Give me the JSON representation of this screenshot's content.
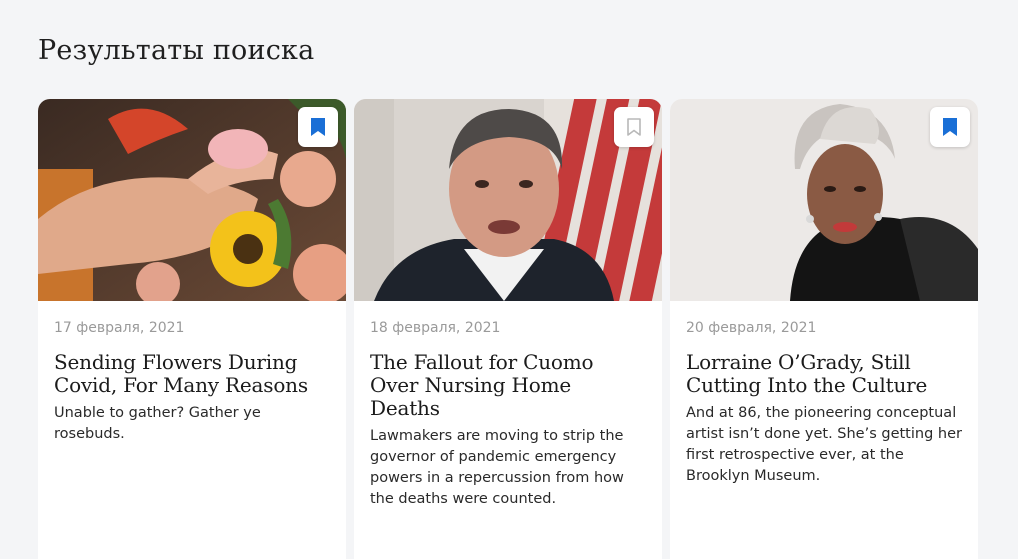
{
  "page": {
    "title": "Результаты поиска"
  },
  "colors": {
    "background": "#f4f5f7",
    "bookmark_active": "#1a6fd6",
    "bookmark_inactive": "#b8b8b8",
    "date_text": "#9a9a9a"
  },
  "cards": [
    {
      "date": "17 февраля, 2021",
      "title": "Sending Flowers During Covid, For Many Reasons",
      "description": "Unable to gather? Gather ye rosebuds.",
      "bookmarked": true,
      "image_icon": "flowers-photo"
    },
    {
      "date": "18 февраля, 2021",
      "title": "The Fallout for Cuomo Over Nursing Home Deaths",
      "description": "Lawmakers are moving to strip the governor of pandemic emergency powers in a repercussion from how the deaths were counted.",
      "bookmarked": false,
      "image_icon": "portrait-photo"
    },
    {
      "date": "20 февраля, 2021",
      "title": "Lorraine O’Grady, Still Cutting Into the Culture",
      "description": "And at 86, the pioneering conceptual artist isn’t done yet. She’s getting her first retrospective ever, at the Brooklyn Museum.",
      "bookmarked": true,
      "image_icon": "portrait-photo"
    }
  ]
}
